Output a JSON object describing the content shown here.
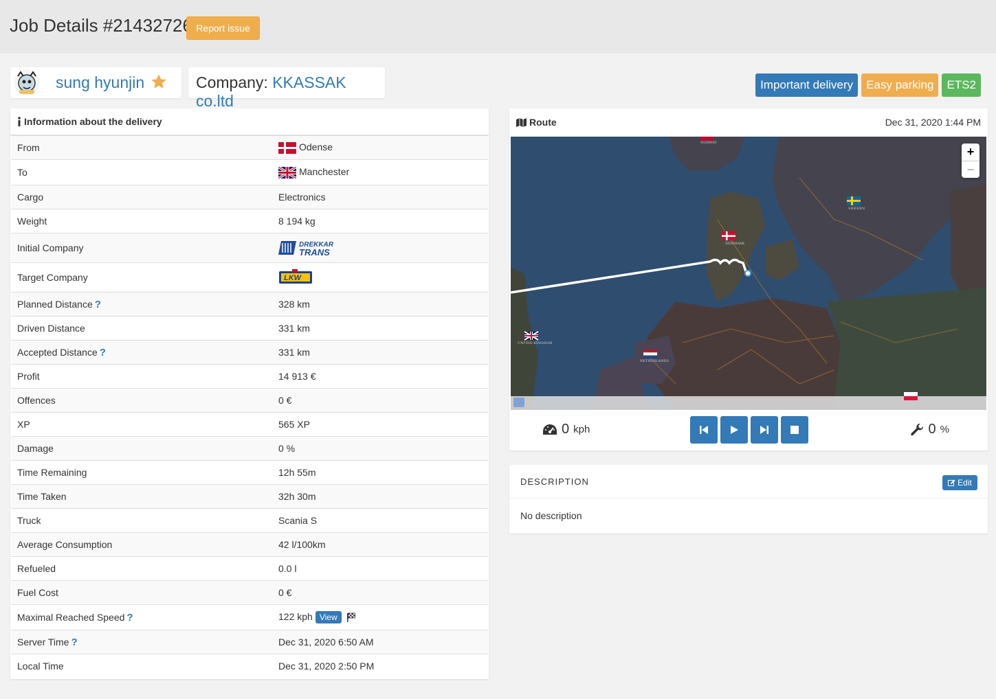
{
  "page": {
    "title": "Job Details #21432726",
    "report_button": "Report issue"
  },
  "user": {
    "name": "sung hyunjin"
  },
  "company": {
    "label": "Company:",
    "name": "KKASSAK co.ltd"
  },
  "badges": [
    "Important delivery",
    "Easy parking",
    "ETS2"
  ],
  "info": {
    "heading": "Information about the delivery",
    "rows": [
      {
        "label": "From",
        "value": "Odense",
        "flag": "denmark"
      },
      {
        "label": "To",
        "value": "Manchester",
        "flag": "uk"
      },
      {
        "label": "Cargo",
        "value": "Electronics"
      },
      {
        "label": "Weight",
        "value": "8 194 kg"
      },
      {
        "label": "Initial Company",
        "logo": "drekkar-trans-logo",
        "logo_text": "DREKKAR TRANS"
      },
      {
        "label": "Target Company",
        "logo": "lkw-logo",
        "logo_text": "LKW"
      },
      {
        "label": "Planned Distance",
        "value": "328 km",
        "help": true
      },
      {
        "label": "Driven Distance",
        "value": "331 km"
      },
      {
        "label": "Accepted Distance",
        "value": "331 km",
        "help": true
      },
      {
        "label": "Profit",
        "value": "14 913 €"
      },
      {
        "label": "Offences",
        "value": "0 €"
      },
      {
        "label": "XP",
        "value": "565 XP"
      },
      {
        "label": "Damage",
        "value": "0 %"
      },
      {
        "label": "Time Remaining",
        "value": "12h 55m"
      },
      {
        "label": "Time Taken",
        "value": "32h 30m"
      },
      {
        "label": "Truck",
        "value": "Scania S"
      },
      {
        "label": "Average Consumption",
        "value": "42 l/100km"
      },
      {
        "label": "Refueled",
        "value": "0.0 l"
      },
      {
        "label": "Fuel Cost",
        "value": "0 €"
      },
      {
        "label": "Maximal Reached Speed",
        "value": "122 kph",
        "help": true,
        "view_button": "View"
      },
      {
        "label": "Server Time",
        "value": "Dec 31, 2020 6:50 AM",
        "help": true
      },
      {
        "label": "Local Time",
        "value": "Dec 31, 2020 2:50 PM"
      }
    ]
  },
  "route": {
    "heading": "Route",
    "date": "Dec 31, 2020 1:44 PM",
    "zoom_in": "+",
    "zoom_out": "−",
    "speed_value": "0",
    "speed_unit": "kph",
    "damage_value": "0",
    "damage_unit": "%",
    "map_labels": [
      "DENMARK",
      "SWEDEN",
      "NORWAY",
      "NETHERLANDS",
      "UNITED KINGDOM"
    ]
  },
  "description": {
    "title": "DESCRIPTION",
    "edit_label": "Edit",
    "text": "No description"
  },
  "colors": {
    "primary": "#337ab7",
    "warning": "#f0ad4e",
    "success": "#5cb85c"
  }
}
